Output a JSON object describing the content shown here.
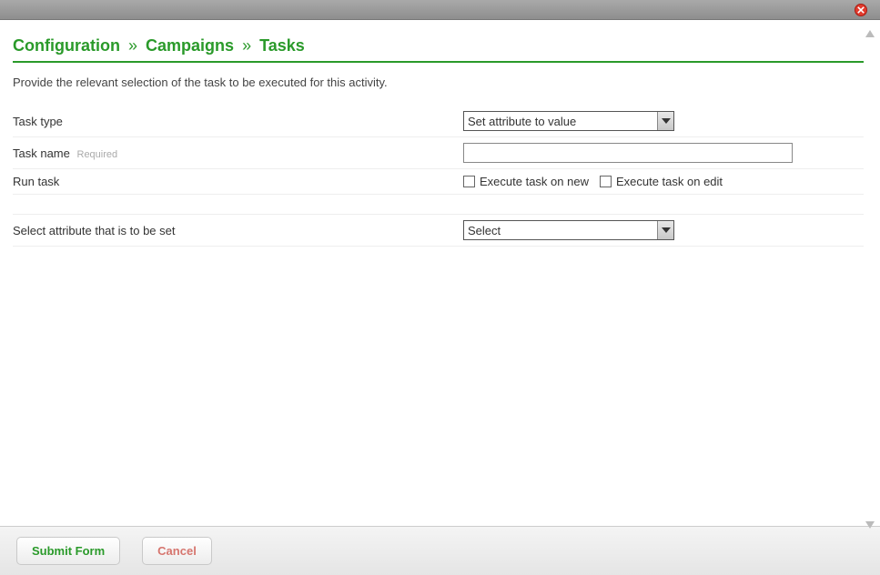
{
  "breadcrumb": {
    "part1": "Configuration",
    "part2": "Campaigns",
    "part3": "Tasks",
    "sep": "»"
  },
  "instruction": "Provide the relevant selection of the task to be executed for this activity.",
  "form": {
    "taskType": {
      "label": "Task type",
      "value": "Set attribute to value"
    },
    "taskName": {
      "label": "Task name",
      "required": "Required",
      "value": ""
    },
    "runTask": {
      "label": "Run task",
      "opt1": "Execute task on new",
      "opt2": "Execute task on edit"
    },
    "selectAttr": {
      "label": "Select attribute that is to be set",
      "value": "Select"
    }
  },
  "buttons": {
    "submit": "Submit Form",
    "cancel": "Cancel"
  }
}
